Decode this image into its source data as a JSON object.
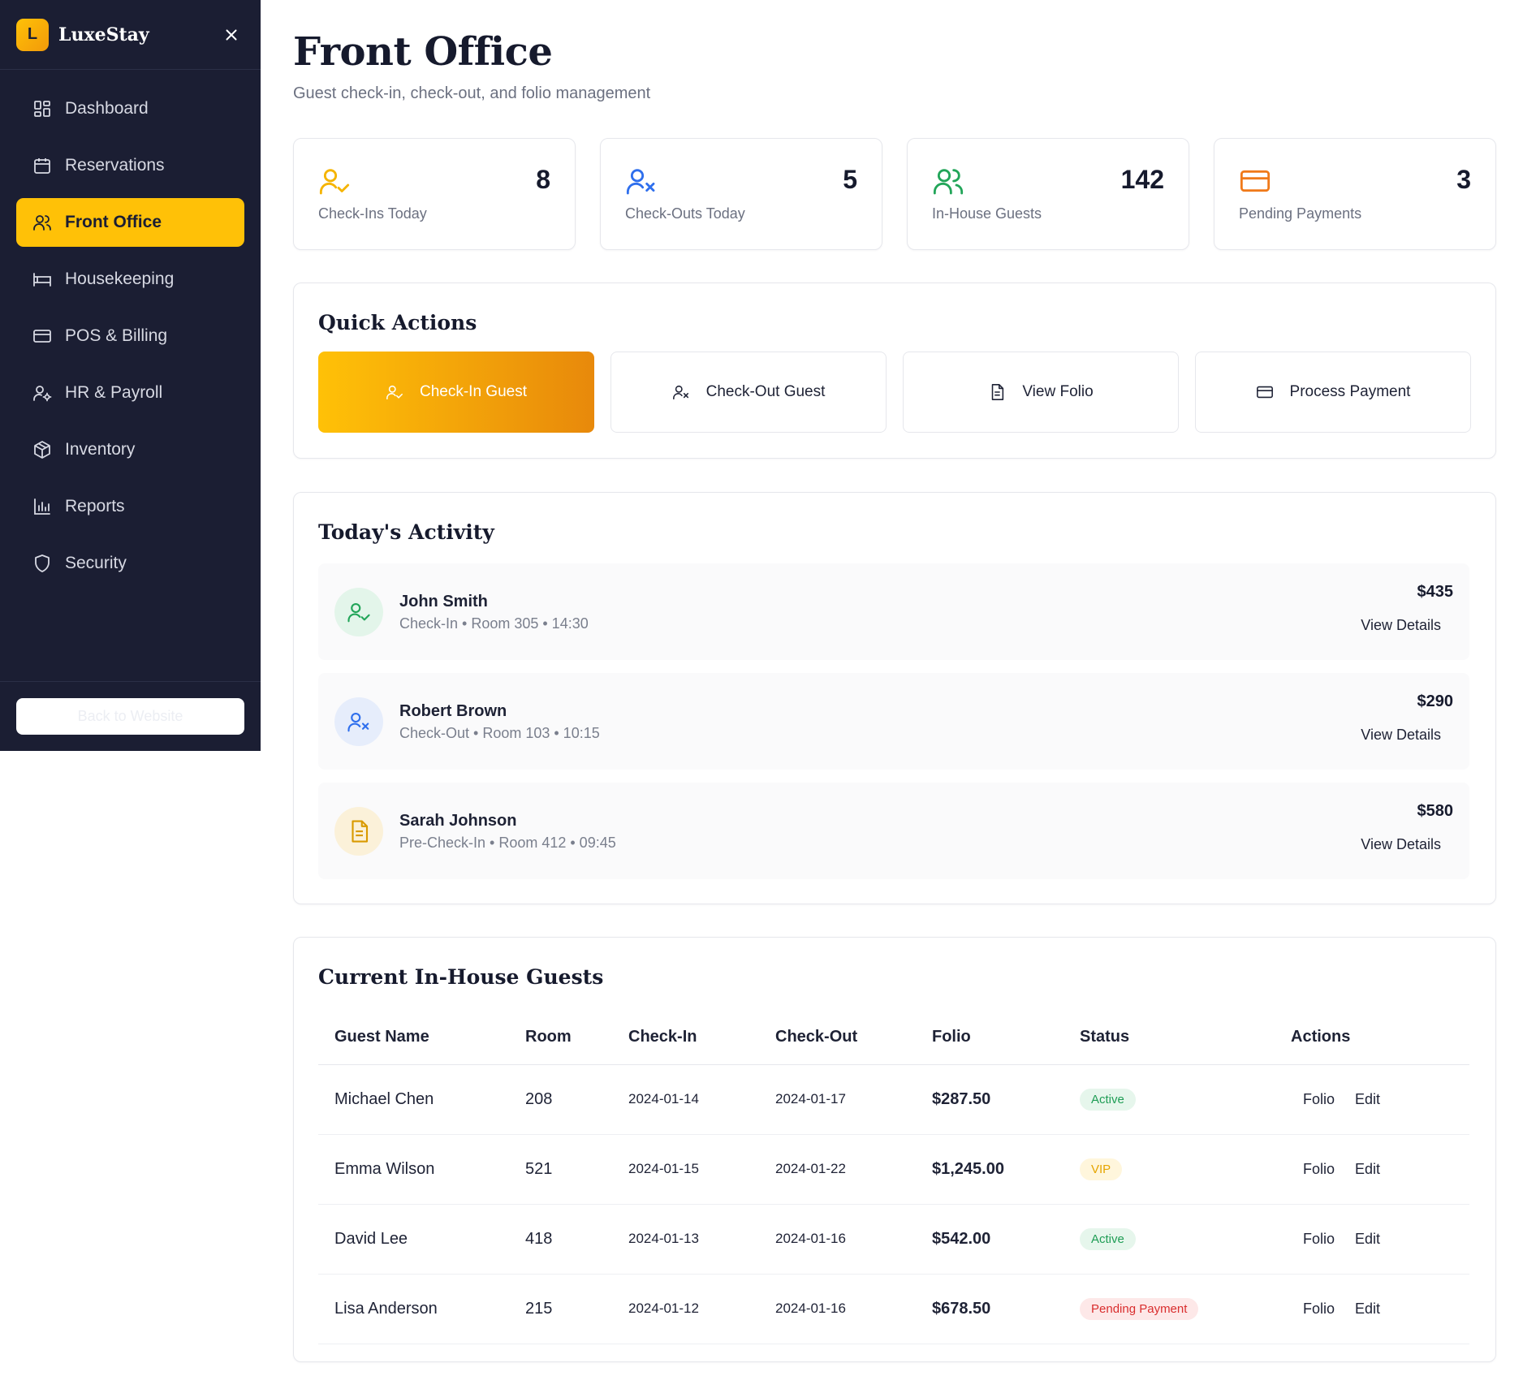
{
  "brand": {
    "logo_letter": "L",
    "name": "LuxeStay"
  },
  "sidebar": {
    "items": [
      {
        "label": "Dashboard",
        "icon": "dashboard-icon",
        "active": false
      },
      {
        "label": "Reservations",
        "icon": "calendar-icon",
        "active": false
      },
      {
        "label": "Front Office",
        "icon": "users-icon",
        "active": true
      },
      {
        "label": "Housekeeping",
        "icon": "bed-icon",
        "active": false
      },
      {
        "label": "POS & Billing",
        "icon": "credit-card-icon",
        "active": false
      },
      {
        "label": "HR & Payroll",
        "icon": "user-gear-icon",
        "active": false
      },
      {
        "label": "Inventory",
        "icon": "package-icon",
        "active": false
      },
      {
        "label": "Reports",
        "icon": "bar-chart-icon",
        "active": false
      },
      {
        "label": "Security",
        "icon": "shield-icon",
        "active": false
      }
    ],
    "back_label": "Back to Website"
  },
  "header": {
    "title": "Front Office",
    "subtitle": "Guest check-in, check-out, and folio management"
  },
  "stats": [
    {
      "value": "8",
      "label": "Check-Ins Today",
      "icon": "user-check-icon",
      "color": "#f5b400"
    },
    {
      "value": "5",
      "label": "Check-Outs Today",
      "icon": "user-x-icon",
      "color": "#2f6fed"
    },
    {
      "value": "142",
      "label": "In-House Guests",
      "icon": "users-icon",
      "color": "#22a559"
    },
    {
      "value": "3",
      "label": "Pending Payments",
      "icon": "credit-card-icon",
      "color": "#f07a1a"
    }
  ],
  "quick_actions": {
    "title": "Quick Actions",
    "items": [
      {
        "label": "Check-In Guest",
        "icon": "user-check-icon"
      },
      {
        "label": "Check-Out Guest",
        "icon": "user-x-icon"
      },
      {
        "label": "View Folio",
        "icon": "document-icon"
      },
      {
        "label": "Process Payment",
        "icon": "credit-card-icon"
      }
    ]
  },
  "activity": {
    "title": "Today's Activity",
    "items": [
      {
        "name": "John Smith",
        "detail": "Check-In • Room 305 • 14:30",
        "amount": "$435",
        "link": "View Details",
        "icon": "user-check-icon",
        "color": "#22a559",
        "bg": "#e3f5ea"
      },
      {
        "name": "Robert Brown",
        "detail": "Check-Out • Room 103 • 10:15",
        "amount": "$290",
        "link": "View Details",
        "icon": "user-x-icon",
        "color": "#2f6fed",
        "bg": "#e6edfb"
      },
      {
        "name": "Sarah Johnson",
        "detail": "Pre-Check-In • Room 412 • 09:45",
        "amount": "$580",
        "link": "View Details",
        "icon": "document-icon",
        "color": "#d99a00",
        "bg": "#fbf1d9"
      }
    ]
  },
  "guests": {
    "title": "Current In-House Guests",
    "columns": [
      "Guest Name",
      "Room",
      "Check-In",
      "Check-Out",
      "Folio",
      "Status",
      "Actions"
    ],
    "rows": [
      {
        "name": "Michael Chen",
        "room": "208",
        "checkin": "2024-01-14",
        "checkout": "2024-01-17",
        "folio": "$287.50",
        "status": "Active",
        "status_type": "active"
      },
      {
        "name": "Emma Wilson",
        "room": "521",
        "checkin": "2024-01-15",
        "checkout": "2024-01-22",
        "folio": "$1,245.00",
        "status": "VIP",
        "status_type": "vip"
      },
      {
        "name": "David Lee",
        "room": "418",
        "checkin": "2024-01-13",
        "checkout": "2024-01-16",
        "folio": "$542.00",
        "status": "Active",
        "status_type": "active"
      },
      {
        "name": "Lisa Anderson",
        "room": "215",
        "checkin": "2024-01-12",
        "checkout": "2024-01-16",
        "folio": "$678.50",
        "status": "Pending Payment",
        "status_type": "pending"
      }
    ],
    "action_folio": "Folio",
    "action_edit": "Edit"
  }
}
